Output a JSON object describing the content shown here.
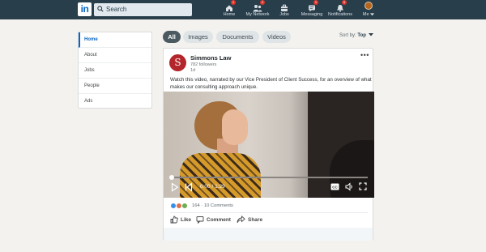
{
  "nav": {
    "search_placeholder": "Search",
    "items": [
      {
        "label": "Home",
        "icon": "home-icon",
        "badge": "1"
      },
      {
        "label": "My Network",
        "icon": "network-icon",
        "badge": "2"
      },
      {
        "label": "Jobs",
        "icon": "briefcase-icon",
        "badge": ""
      },
      {
        "label": "Messaging",
        "icon": "messaging-icon",
        "badge": "1"
      },
      {
        "label": "Notifications",
        "icon": "bell-icon",
        "badge": "5"
      },
      {
        "label": "Me",
        "icon": "avatar",
        "badge": ""
      }
    ]
  },
  "leftmenu": {
    "items": [
      "Home",
      "About",
      "Jobs",
      "People",
      "Ads"
    ],
    "active": "Home"
  },
  "filters": {
    "items": [
      "All",
      "Images",
      "Documents",
      "Videos"
    ],
    "active": "All",
    "sort_label": "Sort by:",
    "sort_value": "Top"
  },
  "post": {
    "author": "Simmons Law",
    "avatar_letter": "S",
    "followers": "782 followers",
    "time": "1d",
    "text": "Watch this video, narrated by our Vice President of Client Success, for an overview of what makes our consulting approach unique.",
    "video": {
      "timecode": "0:00 / 1:29",
      "progress": 0.0
    },
    "reactions_count": "164",
    "comments": "10 Comments",
    "actions": [
      "Like",
      "Comment",
      "Share"
    ]
  },
  "colors": {
    "nav_bg": "#283e4a",
    "accent": "#0a66c2",
    "brand_avatar": "#b3262b",
    "badge": "#e0352b"
  }
}
